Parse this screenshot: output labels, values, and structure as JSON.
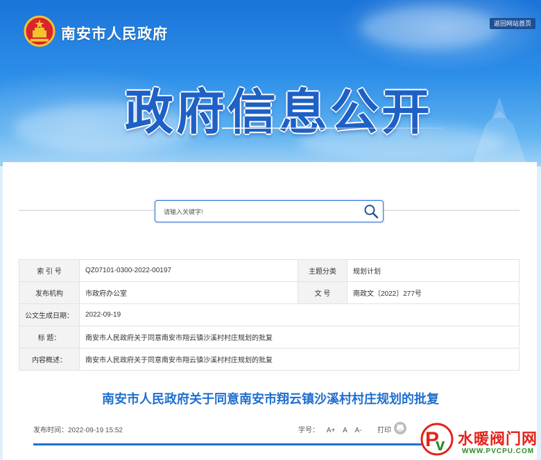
{
  "header": {
    "site_name": "南安市人民政府",
    "back_home": "返回网站首页",
    "hero_title": "政府信息公开"
  },
  "search": {
    "placeholder": "请输入关键字!"
  },
  "info": {
    "index_label": "索 引 号",
    "index_value": "QZ07101-0300-2022-00197",
    "topic_label": "主题分类",
    "topic_value": "规划计划",
    "publisher_label": "发布机构",
    "publisher_value": "市政府办公室",
    "docno_label": "文 号",
    "docno_value": "南政文〔2022〕277号",
    "date_label": "公文生成日期：",
    "date_value": "2022-09-19",
    "title_label": "标 题：",
    "title_value": "南安市人民政府关于同意南安市翔云镇沙溪村村庄规划的批复",
    "summary_label": "内容概述：",
    "summary_value": "南安市人民政府关于同意南安市翔云镇沙溪村村庄规划的批复"
  },
  "article": {
    "title": "南安市人民政府关于同意南安市翔云镇沙溪村村庄规划的批复",
    "publish_time": "发布时间：2022-09-19 15:52",
    "font_size_label": "字号：",
    "font_large": "A+",
    "font_default": "A",
    "font_small": "A-",
    "print_label": "打印"
  },
  "watermark": {
    "brand": "水暖阀门网",
    "url": "WWW.PVCPU.COM"
  },
  "colors": {
    "accent": "#1f6fd0",
    "header_dark": "#1d4f95",
    "watermark_red": "#e2231a"
  }
}
